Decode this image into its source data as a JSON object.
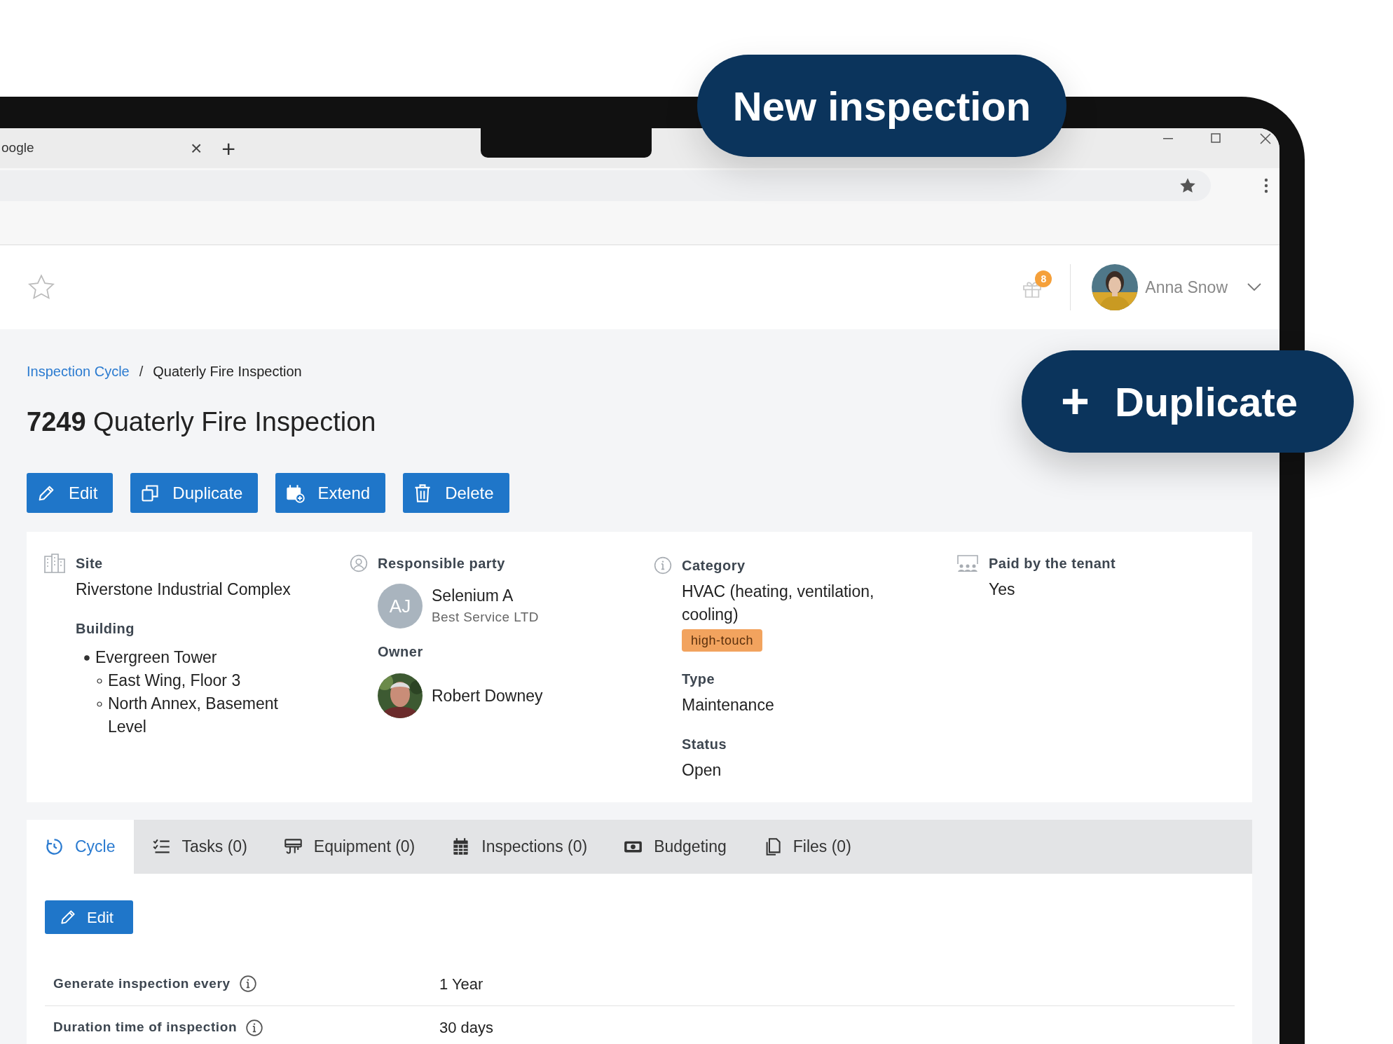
{
  "browser": {
    "tab_title": "oogle",
    "tab_close": "×",
    "new_tab": "+"
  },
  "new_inspection_callout": {
    "label": "New inspection"
  },
  "duplicate_callout": {
    "icon": "+",
    "label": "Duplicate"
  },
  "header": {
    "notification_count": "8",
    "user_name": "Anna Snow"
  },
  "breadcrumb": [
    {
      "label": "Inspection Cycle",
      "kind": "link"
    },
    {
      "label": "/",
      "kind": "separator"
    },
    {
      "label": "Quaterly Fire Inspection",
      "kind": "current"
    }
  ],
  "title": {
    "number": "7249",
    "name": "Quaterly Fire Inspection"
  },
  "actions": [
    {
      "label": "Edit",
      "kind": "edit"
    },
    {
      "label": "Duplicate",
      "kind": "duplicate"
    },
    {
      "label": "Extend",
      "kind": "extend"
    },
    {
      "label": "Delete",
      "kind": "delete"
    }
  ],
  "details": {
    "site": {
      "label": "Site",
      "value": "Riverstone Industrial Complex",
      "building_label": "Building",
      "buildings": [
        {
          "name": "Evergreen Tower",
          "children": [
            {
              "name": "East Wing, Floor 3"
            },
            {
              "name": "North Annex, Basement Level"
            }
          ]
        }
      ]
    },
    "responsible_party": {
      "label": "Responsible party",
      "initials": "AJ",
      "name": "Selenium A",
      "company": "Best Service LTD",
      "owner_label": "Owner",
      "owner_name": "Robert Downey"
    },
    "category": {
      "label": "Category",
      "value": "HVAC (heating, ventilation, cooling)",
      "tag": "high-touch",
      "type_label": "Type",
      "type_value": "Maintenance",
      "status_label": "Status",
      "status_value": "Open"
    },
    "paid_by_tenant": {
      "label": "Paid by the tenant",
      "value": "Yes"
    }
  },
  "tabs": [
    {
      "label": "Cycle",
      "kind": "cycle",
      "selected": true
    },
    {
      "label": "Tasks (0)",
      "kind": "tasks",
      "selected": false
    },
    {
      "label": "Equipment (0)",
      "kind": "equipment",
      "selected": false
    },
    {
      "label": "Inspections (0)",
      "kind": "inspections",
      "selected": false
    },
    {
      "label": "Budgeting",
      "kind": "budgeting",
      "selected": false
    },
    {
      "label": "Files (0)",
      "kind": "files",
      "selected": false
    }
  ],
  "cycle": {
    "edit_button": "Edit",
    "rows": [
      {
        "label": "Generate inspection every",
        "value": "1 Year"
      },
      {
        "label": "Duration time of inspection",
        "value": "30 days"
      }
    ]
  }
}
